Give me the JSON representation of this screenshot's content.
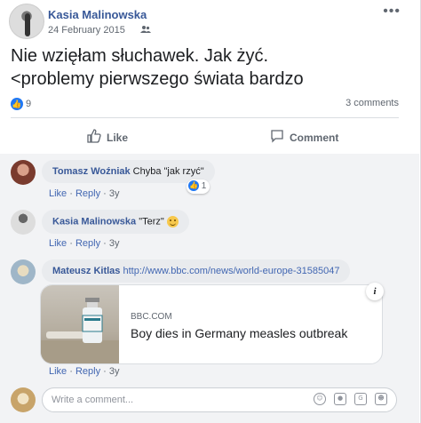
{
  "post": {
    "author": "Kasia Malinowska",
    "date": "24 February 2015",
    "audience_icon": "friends-icon",
    "text_line1": "Nie wzięłam słuchawek. Jak żyć.",
    "text_line2": "<problemy pierwszego świata bardzo",
    "like_count": "9",
    "comment_count": "3 comments",
    "like_label": "Like",
    "comment_label": "Comment"
  },
  "comments": [
    {
      "name": "Tomasz Woźniak",
      "text": "Chyba \"jak rzyć\"",
      "reaction_count": "1",
      "like": "Like",
      "reply": "Reply",
      "time": "3y"
    },
    {
      "name": "Kasia Malinowska",
      "text": "\"Terz\"",
      "like": "Like",
      "reply": "Reply",
      "time": "3y"
    },
    {
      "name": "Mateusz Kitlas",
      "text": "http://www.bbc.com/news/world-europe-31585047",
      "like": "Like",
      "reply": "Reply",
      "time": "3y",
      "link_preview": {
        "domain": "BBC.COM",
        "title": "Boy dies in Germany measles outbreak"
      }
    }
  ],
  "composer": {
    "placeholder": "Write a comment..."
  },
  "colors": {
    "accent": "#385898",
    "like_blue": "#2078f4",
    "comment_bg": "#f2f3f5"
  }
}
